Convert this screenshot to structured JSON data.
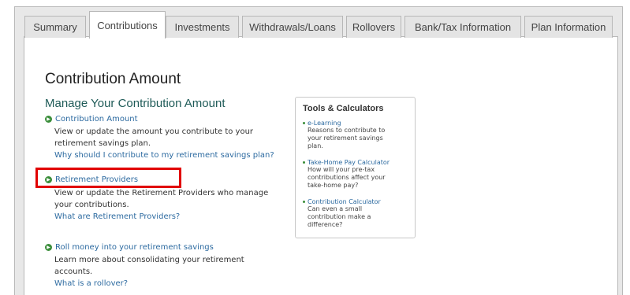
{
  "tabs": [
    {
      "label": "Summary",
      "active": false
    },
    {
      "label": "Contributions",
      "active": true
    },
    {
      "label": "Investments",
      "active": false
    },
    {
      "label": "Withdrawals/Loans",
      "active": false
    },
    {
      "label": "Rollovers",
      "active": false
    },
    {
      "label": "Bank/Tax Information",
      "active": false
    },
    {
      "label": "Plan Information",
      "active": false
    }
  ],
  "main": {
    "title": "Contribution Amount",
    "section_title": "Manage Your Contribution Amount",
    "items": [
      {
        "link": "Contribution Amount",
        "desc": [
          "View or update the amount you contribute to your",
          "retirement savings plan."
        ],
        "sublink": "Why should I contribute to my retirement savings plan?"
      },
      {
        "link": "Retirement Providers",
        "desc": [
          "View or update the Retirement Providers who manage",
          "your contributions."
        ],
        "sublink": "What are Retirement Providers?",
        "highlighted": true
      },
      {
        "link": "Roll money into your retirement savings",
        "desc": [
          "Learn more about consolidating your retirement",
          "accounts."
        ],
        "sublink": "What is a rollover?"
      }
    ]
  },
  "tools": {
    "title": "Tools & Calculators",
    "items": [
      {
        "link": "e-Learning",
        "desc": [
          "Reasons to contribute to",
          "your retirement savings",
          "plan."
        ]
      },
      {
        "link": "Take-Home Pay Calculator",
        "desc": [
          "How will your pre-tax",
          "contributions affect your",
          "take-home pay?"
        ]
      },
      {
        "link": "Contribution Calculator",
        "desc": [
          "Can even a small",
          "contribution make a",
          "difference?"
        ]
      }
    ]
  },
  "colors": {
    "highlight_border": "#e10000",
    "link": "#2c6aa0",
    "section_title": "#1f5b58",
    "bullet": "#3b8e3b"
  }
}
